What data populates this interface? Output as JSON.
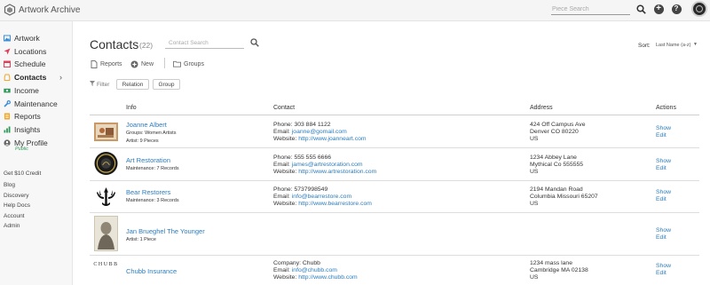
{
  "app": {
    "title": "Artwork Archive"
  },
  "topbar": {
    "search_placeholder": "Piece Search"
  },
  "sidebar": {
    "items": [
      {
        "label": "Artwork",
        "icon": "image-icon",
        "color": "#3a8dd8"
      },
      {
        "label": "Locations",
        "icon": "location-arrow-icon",
        "color": "#e0415a"
      },
      {
        "label": "Schedule",
        "icon": "calendar-icon",
        "color": "#e0415a"
      },
      {
        "label": "Contacts",
        "icon": "contacts-icon",
        "color": "#f2a623",
        "active": true
      },
      {
        "label": "Income",
        "icon": "money-icon",
        "color": "#2e9a5a"
      },
      {
        "label": "Maintenance",
        "icon": "wrench-icon",
        "color": "#3a8dd8"
      },
      {
        "label": "Reports",
        "icon": "reports-icon",
        "color": "#f2a623"
      },
      {
        "label": "Insights",
        "icon": "chart-icon",
        "color": "#2e9a5a"
      },
      {
        "label": "My Profile",
        "icon": "user-icon",
        "color": "#666666"
      }
    ],
    "profile_status": "Public",
    "links": [
      "Get $10 Credit",
      "Blog",
      "Discovery",
      "Help Docs",
      "Account",
      "Admin"
    ]
  },
  "main": {
    "title": "Contacts",
    "count": "(22)",
    "search_placeholder": "Contact Search",
    "sort_label": "Sort:",
    "sort_value": "Last Name (a-z)",
    "toolbar": {
      "reports": "Reports",
      "new": "New",
      "groups": "Groups"
    },
    "filter": {
      "label": "Filter",
      "relation": "Relation",
      "group": "Group"
    },
    "columns": {
      "info": "Info",
      "contact": "Contact",
      "address": "Address",
      "actions": "Actions"
    },
    "actions": {
      "show": "Show",
      "edit": "Edit"
    },
    "rows": [
      {
        "name": "Joanne Albert",
        "meta": [
          "Groups: Women Artists",
          "Artist: 9 Pieces"
        ],
        "contact": [
          {
            "label": "Phone: ",
            "value": "303 884 1122",
            "link": false
          },
          {
            "label": "Email: ",
            "value": "joanne@gomail.com",
            "link": true
          },
          {
            "label": "Website: ",
            "value": "http://www.joanneart.com",
            "link": true
          }
        ],
        "address": [
          "424 Off Campus Ave",
          "Denver CO 80220",
          "US"
        ]
      },
      {
        "name": "Art Restoration",
        "meta": [
          "Maintenance: 7 Records"
        ],
        "contact": [
          {
            "label": "Phone: ",
            "value": "555 555 6666",
            "link": false
          },
          {
            "label": "Email: ",
            "value": "james@artrestoration.com",
            "link": true
          },
          {
            "label": "Website: ",
            "value": "http://www.artrestoration.com",
            "link": true
          }
        ],
        "address": [
          "1234 Abbey Lane",
          "Mythical Co 555555",
          "US"
        ]
      },
      {
        "name": "Bear Restorers",
        "meta": [
          "Maintenance: 3 Records"
        ],
        "contact": [
          {
            "label": "Phone: ",
            "value": "5737998549",
            "link": false
          },
          {
            "label": "Email: ",
            "value": "info@bearrestore.com",
            "link": true
          },
          {
            "label": "Website: ",
            "value": "http://www.bearrestore.com",
            "link": true
          }
        ],
        "address": [
          "2194 Mandan Road",
          "Columbia Missouri 65207",
          "US"
        ]
      },
      {
        "name": "Jan Brueghel The Younger",
        "meta": [
          "Artist: 1 Piece"
        ],
        "contact": [],
        "address": []
      },
      {
        "name": "Chubb Insurance",
        "meta": [],
        "logo_text": "CHUBB",
        "contact": [
          {
            "label": "Company: ",
            "value": "Chubb",
            "link": false
          },
          {
            "label": "Email: ",
            "value": "info@chubb.com",
            "link": true
          },
          {
            "label": "Website: ",
            "value": "http://www.chubb.com",
            "link": true
          }
        ],
        "address": [
          "1234 mass lane",
          "Cambridge MA 02138",
          "US"
        ]
      }
    ]
  }
}
